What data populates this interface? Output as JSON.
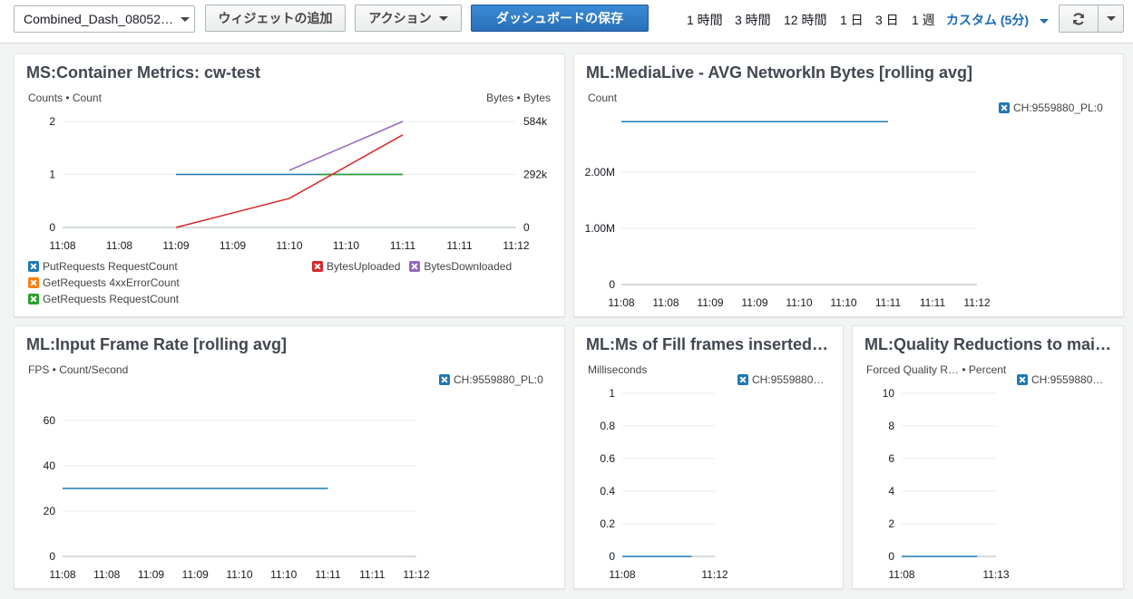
{
  "toolbar": {
    "dashboard_name": "Combined_Dash_08052…",
    "add_widget": "ウィジェットの追加",
    "actions": "アクション",
    "save": "ダッシュボードの保存",
    "ranges": [
      "1 時間",
      "3 時間",
      "12 時間",
      "1 日",
      "3 日",
      "1 週"
    ],
    "custom_range": "カスタム (5分)"
  },
  "colors": {
    "blue": "#1f77b4",
    "orange": "#ff7f0e",
    "green": "#2ca02c",
    "red": "#d62728",
    "purple": "#9467bd",
    "link": "#1b6bb5"
  },
  "widgets": {
    "w1": {
      "title": "MS:Container Metrics: cw-test",
      "left_unit": "Counts • Count",
      "right_unit": "Bytes • Bytes",
      "legend_left": [
        "PutRequests RequestCount",
        "GetRequests 4xxErrorCount",
        "GetRequests RequestCount"
      ],
      "legend_right": [
        "BytesUploaded",
        "BytesDownloaded"
      ]
    },
    "w2": {
      "title": "ML:MediaLive - AVG NetworkIn Bytes [rolling avg]",
      "unit": "Count",
      "legend": [
        "CH:9559880_PL:0"
      ]
    },
    "w3": {
      "title": "ML:Input Frame Rate [rolling avg]",
      "unit": "FPS • Count/Second",
      "legend": [
        "CH:9559880_PL:0"
      ]
    },
    "w4": {
      "title": "ML:Ms of Fill frames inserted…",
      "unit": "Milliseconds",
      "legend": [
        "CH:9559880…"
      ]
    },
    "w5": {
      "title": "ML:Quality Reductions to mai…",
      "unit": "Forced Quality R… • Percent",
      "legend": [
        "CH:9559880…"
      ]
    }
  },
  "chart_data": [
    {
      "type": "line",
      "title": "MS:Container Metrics: cw-test",
      "x_ticks": [
        "11:08",
        "11:08",
        "11:09",
        "11:09",
        "11:10",
        "11:10",
        "11:11",
        "11:11",
        "11:12"
      ],
      "left_axis": {
        "label": "Counts • Count",
        "ticks": [
          "0",
          "1",
          "2"
        ],
        "ylim": [
          0,
          2
        ]
      },
      "right_axis": {
        "label": "Bytes • Bytes",
        "ticks": [
          "0",
          "292k",
          "584k"
        ],
        "ylim": [
          0,
          584000
        ]
      },
      "series": [
        {
          "name": "PutRequests RequestCount",
          "color": "blue",
          "axis": "left",
          "points": [
            [
              2,
              1
            ],
            [
              6,
              1
            ]
          ]
        },
        {
          "name": "GetRequests 4xxErrorCount",
          "color": "orange",
          "axis": "left",
          "points": []
        },
        {
          "name": "GetRequests RequestCount",
          "color": "green",
          "axis": "left",
          "points": [
            [
              4.5,
              1
            ],
            [
              6,
              1
            ]
          ]
        },
        {
          "name": "BytesUploaded",
          "color": "red",
          "axis": "right",
          "points": [
            [
              2,
              0
            ],
            [
              4,
              160000
            ],
            [
              6,
              510000
            ]
          ]
        },
        {
          "name": "BytesDownloaded",
          "color": "purple",
          "axis": "right",
          "points": [
            [
              4,
              315000
            ],
            [
              6,
              584000
            ]
          ]
        }
      ]
    },
    {
      "type": "line",
      "title": "ML:MediaLive - AVG NetworkIn Bytes [rolling avg]",
      "x_ticks": [
        "11:08",
        "11:08",
        "11:09",
        "11:09",
        "11:10",
        "11:10",
        "11:11",
        "11:11",
        "11:12"
      ],
      "y_ticks": [
        "0",
        "1.00M",
        "2.00M"
      ],
      "ylim": [
        0,
        3000000
      ],
      "series": [
        {
          "name": "CH:9559880_PL:0",
          "color": "blue",
          "points": [
            [
              0,
              2900000
            ],
            [
              6,
              2900000
            ]
          ]
        }
      ]
    },
    {
      "type": "line",
      "title": "ML:Input Frame Rate [rolling avg]",
      "x_ticks": [
        "11:08",
        "11:08",
        "11:09",
        "11:09",
        "11:10",
        "11:10",
        "11:11",
        "11:11",
        "11:12"
      ],
      "y_ticks": [
        "0",
        "20",
        "40",
        "60"
      ],
      "ylim": [
        0,
        60
      ],
      "series": [
        {
          "name": "CH:9559880_PL:0",
          "color": "blue",
          "points": [
            [
              0,
              30
            ],
            [
              6,
              30
            ]
          ]
        }
      ]
    },
    {
      "type": "line",
      "title": "ML:Ms of Fill frames inserted…",
      "x_ticks": [
        "11:08",
        "11:12"
      ],
      "y_ticks": [
        "0",
        "0.2",
        "0.4",
        "0.6",
        "0.8",
        "1"
      ],
      "ylim": [
        0,
        1
      ],
      "series": [
        {
          "name": "CH:9559880…",
          "color": "blue",
          "points": [
            [
              0,
              0
            ],
            [
              0.75,
              0
            ]
          ]
        }
      ]
    },
    {
      "type": "line",
      "title": "ML:Quality Reductions to mai…",
      "x_ticks": [
        "11:08",
        "11:13"
      ],
      "y_ticks": [
        "0",
        "2",
        "4",
        "6",
        "8",
        "10"
      ],
      "ylim": [
        0,
        10
      ],
      "series": [
        {
          "name": "CH:9559880…",
          "color": "blue",
          "points": [
            [
              0,
              0
            ],
            [
              0.8,
              0
            ]
          ]
        }
      ]
    }
  ]
}
